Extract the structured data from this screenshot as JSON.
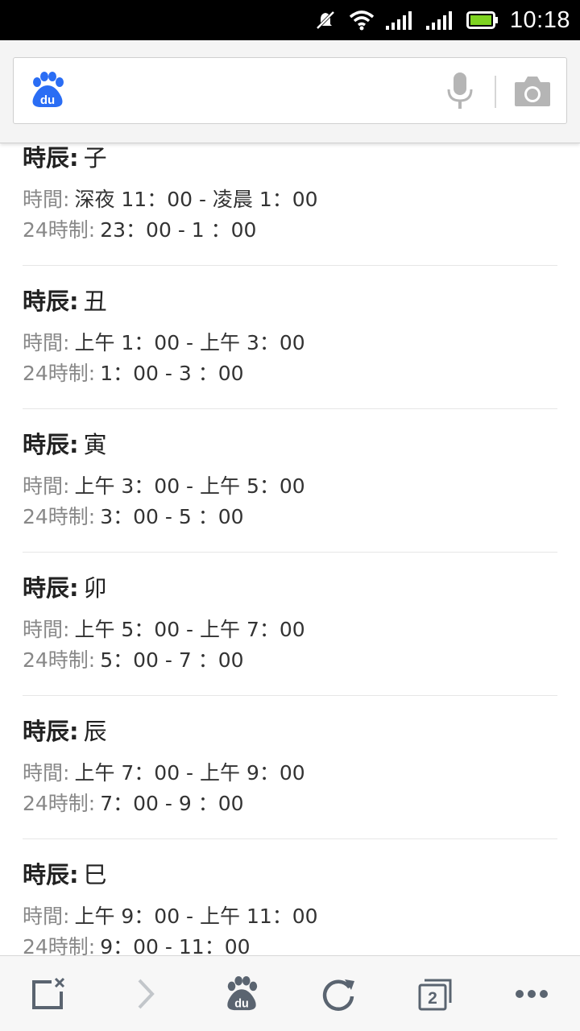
{
  "status_bar": {
    "time": "10:18",
    "icons": [
      "notifications-muted-icon",
      "wifi-icon",
      "signal-icon",
      "signal-icon",
      "battery-icon"
    ],
    "battery_color": "#7ed321"
  },
  "search": {
    "logo": "baidu-logo",
    "logo_text": "du",
    "placeholder": "",
    "value": "",
    "voice_icon": "mic-icon",
    "camera_icon": "camera-icon",
    "brand_color": "#2a6df4"
  },
  "entries": [
    {
      "label": "時辰:",
      "branch": "子",
      "time_label": "時間:",
      "time": "深夜 11：00 - 凌晨 1：00",
      "h24_label": "24時制:",
      "h24": "23：00 - 1 ：00"
    },
    {
      "label": "時辰:",
      "branch": "丑",
      "time_label": "時間:",
      "time": "上午 1：00 - 上午 3：00",
      "h24_label": "24時制:",
      "h24": "1：00 - 3 ：00"
    },
    {
      "label": "時辰:",
      "branch": "寅",
      "time_label": "時間:",
      "time": "上午 3：00 - 上午 5：00",
      "h24_label": "24時制:",
      "h24": "3：00 - 5 ：00"
    },
    {
      "label": "時辰:",
      "branch": "卯",
      "time_label": "時間:",
      "time": "上午 5：00 - 上午 7：00",
      "h24_label": "24時制:",
      "h24": "5：00 - 7 ：00"
    },
    {
      "label": "時辰:",
      "branch": "辰",
      "time_label": "時間:",
      "time": "上午 7：00 - 上午 9：00",
      "h24_label": "24時制:",
      "h24": "7：00 - 9 ：00"
    },
    {
      "label": "時辰:",
      "branch": "巳",
      "time_label": "時間:",
      "time": "上午 9：00 - 上午 11：00",
      "h24_label": "24時制:",
      "h24": "9：00 - 11：00"
    }
  ],
  "bottom_nav": {
    "items": [
      {
        "icon": "close-page-icon"
      },
      {
        "icon": "forward-icon",
        "disabled": true
      },
      {
        "icon": "baidu-home-icon",
        "text": "du"
      },
      {
        "icon": "refresh-icon"
      },
      {
        "icon": "tabs-icon",
        "count": "2"
      },
      {
        "icon": "more-icon"
      }
    ]
  }
}
